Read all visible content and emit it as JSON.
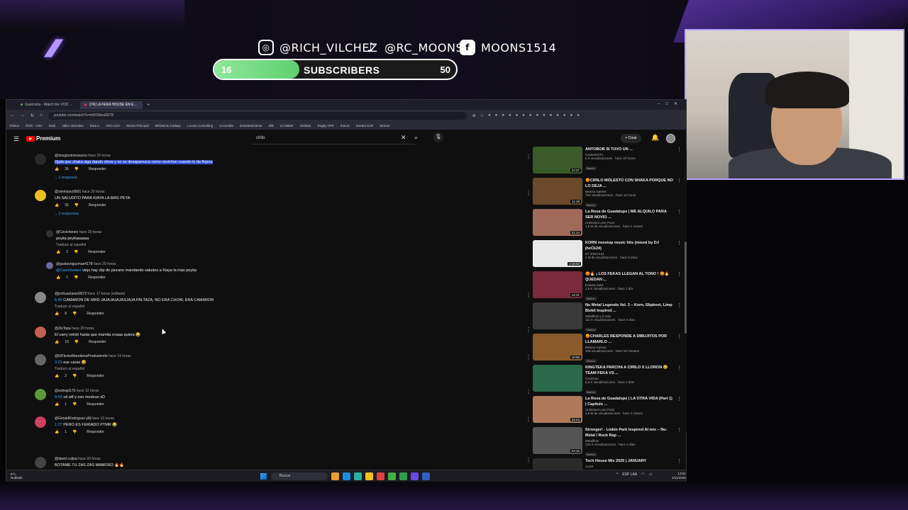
{
  "overlay": {
    "instagram": "@RICH_VILCHEZ",
    "tiktok": "@RC_MOONS",
    "facebook": "MOONS1514",
    "subs_current": "16",
    "subs_label": "SUBSCRIBERS",
    "subs_goal": "50",
    "subs_progress": 0.32
  },
  "browser": {
    "tabs": [
      "Guelcoins - Watch the VOD ...",
      "(74) LA FEKA HOUSE EN E..."
    ],
    "url": "youtube.com/watch?v=mROkIoa0D78",
    "bookmarks": [
      "Vídeos",
      "ROG - USA",
      "Sock",
      "Jallor Interview",
      "Dota 2",
      "VISA USA",
      "Moran Principal",
      "Mérited & Inadapc",
      "Lorcas Consulting",
      "Uccenrilla",
      "Entretenimiento",
      "Silk",
      "LV Maker",
      "Globant",
      "Rugby HPK",
      "Iharca",
      "Stream Kids",
      "Stream"
    ]
  },
  "youtube": {
    "logo": "Premium",
    "search_query": "cirilo",
    "create_label": "Crear",
    "notif_count": "9+"
  },
  "comments": [
    {
      "user": "@douglastorresuxco",
      "time": "hace 20 horas",
      "text": "Ojala que shaka siga dando show y no se desaparezca como cevichon cuando le da flojera",
      "likes": "39",
      "reply_label": "Responder",
      "replies": "1 respuesta",
      "highlight": true
    },
    {
      "user": "@xiirolopez9561",
      "time": "hace 20 horas",
      "text": "UN SALUDITO PARA KIAYA LA MAS PEYA",
      "likes": "35",
      "reply_label": "Responder",
      "replies": "2 respuestas"
    },
    {
      "user": "@Cevichenex",
      "time": "hace 20 horas",
      "text": "peyita peyitaaaaaa",
      "translate": "Traducir al español",
      "likes": "2",
      "reply_label": "Responder"
    },
    {
      "user": "@gustavoguzman4178",
      "time": "hace 20 horas",
      "mention": "@Cavichwaee",
      "text": "viejo hay clip de piurano mandando saludos a Kiaya la más peyita",
      "likes": "1",
      "reply_label": "Responder"
    },
    {
      "user": "@joshuaclaxes9572",
      "time": "hace 17 horas (editado)",
      "ts": "6:40",
      "text": "CAMARON DE MRD JAJAJAJAJASJAJA PALTAZA, NO ERA CHOW, ERA CAMARON",
      "translate": "Traducir al español",
      "likes": "8",
      "reply_label": "Responder"
    },
    {
      "user": "@ZixTopa",
      "time": "hace 20 horas",
      "text": "El carry volvió hasta que mamita evaaa quiera 😂",
      "likes": "10",
      "reply_label": "Responder"
    },
    {
      "user": "@ElFlexkoMandamaProduciendo",
      "time": "hace 14 horas",
      "ts": "3:23",
      "text": "ese caras 😂",
      "translate": "Traducir al español",
      "likes": "2",
      "reply_label": "Responder"
    },
    {
      "user": "@esfexpl175",
      "time": "hace 12 horas",
      "ts": "9:53",
      "text": "xd wtf y eso mostruo xD",
      "likes": "1",
      "reply_label": "Responder"
    },
    {
      "user": "@GeraldRodriguez-y8j",
      "time": "hace 15 horas",
      "ts": "1:27",
      "text": "PERO ES FERIADO PTMR 😂",
      "likes": "1",
      "reply_label": "Responder"
    },
    {
      "user": "@david.cutipa",
      "time": "hace 20 horas",
      "text": "BOTAME TU ZAS ZAS MAMOSO 🔥🔥"
    }
  ],
  "videos": [
    {
      "title": "ANTOBOB SI TUVO UN ...",
      "channel": "CSdesDOTA",
      "meta": "5 K visualizaciones · hace 20 horas",
      "badge": "Nuevo",
      "duration": "22:37",
      "thumb": "#3a5a2a"
    },
    {
      "title": "😡CIRILO MOLESTO CON SHAKA PORQUE NO LO DEJA ...",
      "channel": "Batosa Games",
      "meta": "752 visualizaciones · hace 16 horas",
      "badge": "Nuevo",
      "duration": "11:18",
      "thumb": "#6a4a2a"
    },
    {
      "title": "La Rosa de Guadalupe | ME ALQUILO PARA SER NOVIO ...",
      "channel": "Unlimited Love Point",
      "meta": "1,6 M de visualizaciones · hace 2 meses",
      "badge": "",
      "duration": "21:14",
      "thumb": "#a06a5a"
    },
    {
      "title": "KORN nonstop music hits (mixed by DJ jheCk24)",
      "channel": "DJ JHECK24",
      "meta": "2 M de visualizaciones · hace 5 años",
      "badge": "",
      "duration": "1:16:02",
      "thumb": "#e8e8e8"
    },
    {
      "title": "😡🔥 ¡ LOS FEKAS LLEGAN AL TONO ! 😡🔥 QUEDAN ...",
      "channel": "Dakota Dota",
      "meta": "1,6 K visualizaciones · hace 1 día",
      "badge": "Nuevo",
      "duration": "12:21",
      "thumb": "#7a2a3a"
    },
    {
      "title": "Nu Metal Legends Vol. 3 – Korn, Slipknot, Limp Bizkit Inspired ...",
      "channel": "Metalflow y 3 más",
      "meta": "111 K visualizaciones · hace 5 días",
      "badge": "Nuevo",
      "duration": "",
      "thumb": "#3a3a3a"
    },
    {
      "title": "😡CHARLES RESPONDE A DIBUJITOS POR LLAMARLO ...",
      "channel": "Batosa Games",
      "meta": "109 visualizaciones · hace 56 minutos",
      "badge": "Nuevo",
      "duration": "10:58",
      "thumb": "#8a5a2a"
    },
    {
      "title": "KINGTEKA PARCHA A CIRILO X LLORON 😂 TEAM FEKA VS ...",
      "channel": "Cevichon",
      "meta": "6,6 K visualizaciones · hace 2 días",
      "badge": "Nuevo",
      "duration": "",
      "thumb": "#2a6a4a"
    },
    {
      "title": "La Rosa de Guadalupe | LA OTRA VIDA (Part 1) | Capítulo ...",
      "channel": "Unlimited Love Point",
      "meta": "1,6 M de visualizaciones · hace 3 meses",
      "badge": "",
      "duration": "34:24",
      "thumb": "#b07a5a"
    },
    {
      "title": "Stronger! - Linkin Park Inspired AI mix – Nu-Metal / Rock Rap ...",
      "channel": "Metalflow",
      "meta": "134 K visualizaciones · hace 2 días",
      "badge": "Nuevo",
      "duration": "02:15",
      "thumb": "#555555"
    },
    {
      "title": "Tech House Mix 2025 | JANUARY",
      "channel": "ALEX",
      "meta": "",
      "badge": "",
      "duration": "",
      "thumb": "#2a2a2a"
    }
  ],
  "taskbar": {
    "weather_temp": "8°C",
    "weather_desc": "Nublado",
    "search_label": "Buscar",
    "lang": "ESP LAA",
    "time": "13:51",
    "date": "1/11/2025"
  }
}
